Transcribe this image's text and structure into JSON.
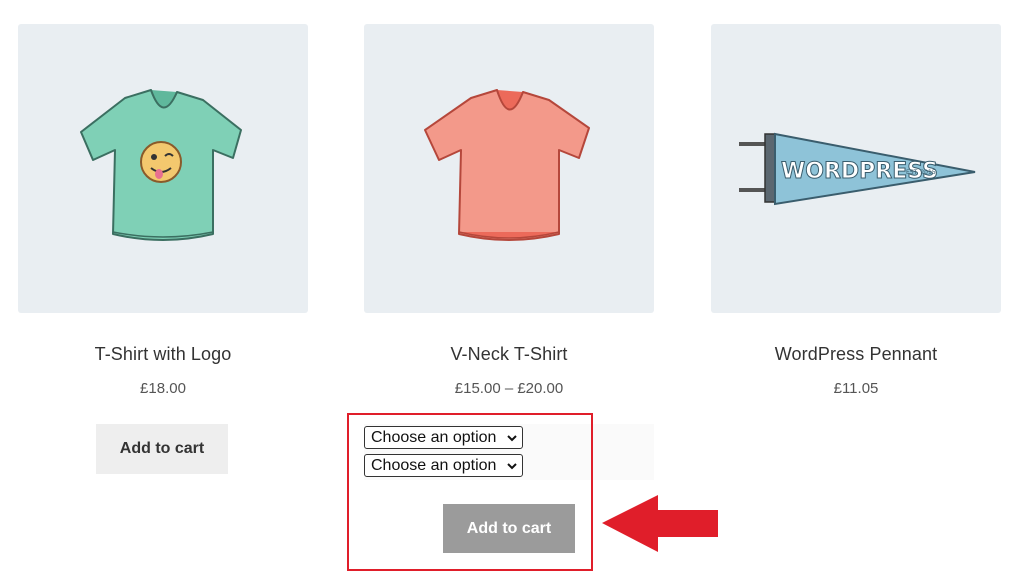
{
  "products": [
    {
      "name": "T-Shirt with Logo",
      "price": "£18.00",
      "image_icon": "tshirt-logo-image",
      "button_label": "Add to cart"
    },
    {
      "name": "V-Neck T-Shirt",
      "price": "£15.00 – £20.00",
      "image_icon": "vneck-tshirt-image",
      "options": [
        {
          "selected": "Choose an option"
        },
        {
          "selected": "Choose an option"
        }
      ],
      "button_label": "Add to cart"
    },
    {
      "name": "WordPress Pennant",
      "price": "£11.05",
      "image_icon": "wordpress-pennant-image",
      "pennant_text": "WORDPRESS"
    }
  ],
  "colors": {
    "thumb_bg": "#e9eef2",
    "highlight": "#e01e2a",
    "disabled_button": "#9b9b9b",
    "default_button": "#eeeeee"
  }
}
